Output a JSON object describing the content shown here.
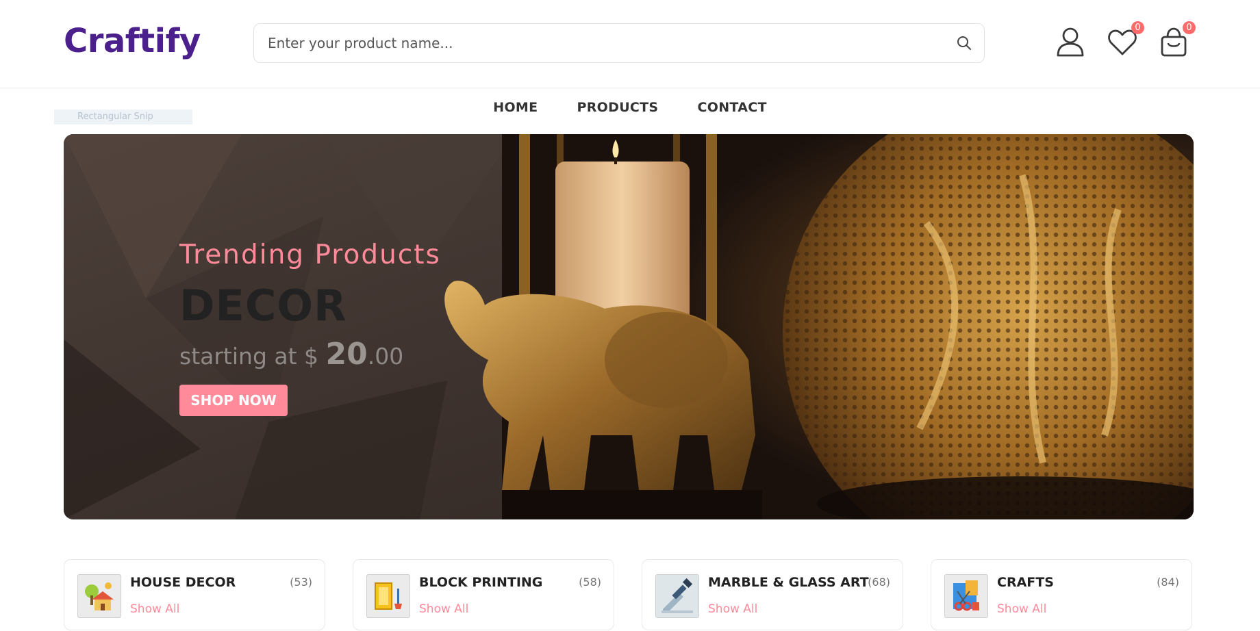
{
  "brand": {
    "name": "Craftify",
    "color": "#4b1f8c"
  },
  "search": {
    "placeholder": "Enter your product name..."
  },
  "header_icons": [
    {
      "name": "account-icon"
    },
    {
      "name": "heart-icon",
      "badge": "0"
    },
    {
      "name": "shopping-bag-icon",
      "badge": "0"
    }
  ],
  "nav": {
    "items": [
      "HOME",
      "PRODUCTS",
      "CONTACT"
    ]
  },
  "overlay_ghost": "Rectangular Snip",
  "hero": {
    "subtitle": "Trending Products",
    "title": "DECOR",
    "price_prefix": "starting at $",
    "price_main": "20",
    "price_cents": ".00",
    "button": "SHOP NOW",
    "accent": "#ff8a9a"
  },
  "categories": [
    {
      "name": "HOUSE DECOR",
      "count": "(53)",
      "link": "Show All",
      "icon": "house-decor-icon"
    },
    {
      "name": "BLOCK PRINTING",
      "count": "(58)",
      "link": "Show All",
      "icon": "block-printing-icon"
    },
    {
      "name": "MARBLE & GLASS ART",
      "count": "(68)",
      "link": "Show All",
      "icon": "marble-glass-art-icon"
    },
    {
      "name": "CRAFTS",
      "count": "(84)",
      "link": "Show All",
      "icon": "crafts-icon"
    }
  ]
}
